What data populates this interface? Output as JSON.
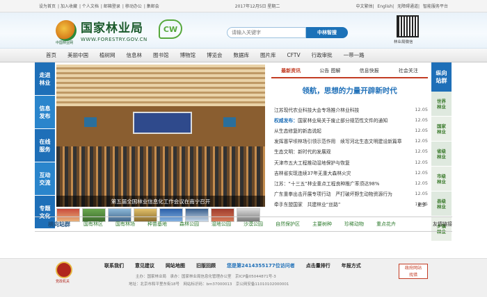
{
  "topbar": {
    "links": [
      "设为首页",
      "加入收藏",
      "个人文档",
      "邮箱登录",
      "移动办公",
      "集邮会"
    ],
    "date": "2017年12月5日 星期二",
    "right_links": [
      "中文繁体",
      "English",
      "无障碍通道",
      "智能服务平台"
    ]
  },
  "header": {
    "logo_cn": "国家林业局",
    "logo_en": "WWW.FORESTRY.GOV.CN",
    "logo_sub": "中国林业网",
    "emblem_text": "CW",
    "search_placeholder": "请输入关键字",
    "search_button": "中林智搜",
    "qr_label": "林业局微信"
  },
  "nav": [
    "首页",
    "美丽中国",
    "植树网",
    "信息林",
    "图书馆",
    "博物馆",
    "博览会",
    "数据库",
    "图片库",
    "CFTV",
    "行政审批",
    "一带一路"
  ],
  "left_tabs": [
    "走进林业",
    "信息发布",
    "在线服务",
    "互动交流",
    "专题文化"
  ],
  "photo": {
    "caption": "第五届全国林业信息化工作会议在南宁召开"
  },
  "news": {
    "tabs": [
      "最新资讯",
      "公告 图解",
      "信息快报",
      "社会关注"
    ],
    "active_tab": 0,
    "headline": "领航，思想的力量开辟新时代",
    "items": [
      {
        "prefix": "",
        "title": "江苏现代农业科技大会专场推介林业科技",
        "date": "12.05"
      },
      {
        "prefix": "权威发布：",
        "title": "国家林业局关于废止部分规范性文件的通知",
        "date": "12.05"
      },
      {
        "prefix": "",
        "title": "从生态修复的新态说起",
        "date": "12.05"
      },
      {
        "prefix": "",
        "title": "发挥塞罕坝林场引领示范作用　续写河北生态文明建设新篇章",
        "date": "12.05"
      },
      {
        "prefix": "",
        "title": "生态文明：新时代的发展观",
        "date": "12.05"
      },
      {
        "prefix": "",
        "title": "天津市五大工程推动湿地保护与恢复",
        "date": "12.05"
      },
      {
        "prefix": "",
        "title": "吉林省实现连续37年无重大森林火灾",
        "date": "12.05"
      },
      {
        "prefix": "",
        "title": "江苏：“十三五”林业重点工程良种推广率须达98%",
        "date": "12.05"
      },
      {
        "prefix": "",
        "title": "广东重拳出击开展专项行动　严打破坏野生动物资源行为",
        "date": "12.05"
      },
      {
        "prefix": "",
        "title": "牵手东盟国家　共建林业“丝路”",
        "date": "12.05"
      }
    ],
    "more": "更多"
  },
  "right_tabs": {
    "head": "纵向站群",
    "items": [
      "世界林业",
      "国家林业",
      "省级林业",
      "市级林业",
      "县级林业",
      "乡镇林业"
    ]
  },
  "site_row": {
    "label": "横向站群",
    "links": [
      "国有林区",
      "国有林场",
      "种苗基地",
      "森林公园",
      "湿地公园",
      "沙漠公园",
      "自然保护区",
      "主要树种",
      "珍稀动物",
      "重点花卉"
    ],
    "friend": "友情链接"
  },
  "footer": {
    "badge_label": "党政机关",
    "links": [
      "联系我们",
      "意见建议",
      "网站地图",
      "旧版回顾",
      "您是第2414355177位访问者",
      "点击量排行",
      "年报方式"
    ],
    "line1": "主办：国家林业局　承办：国家林业局信息化管理办公室　京ICP备05044871号-3",
    "line2": "地址：北京市和平里东街18号　网站标识码：bm37000013　京公网安备11010102000001",
    "gov_line1": "政府网站",
    "gov_line2": "找错"
  }
}
